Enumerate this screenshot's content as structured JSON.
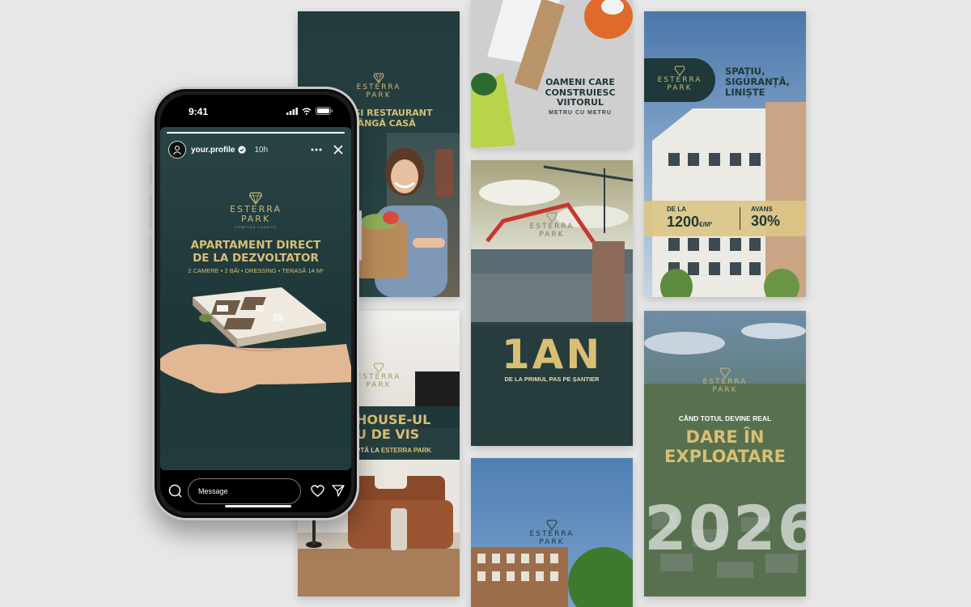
{
  "phone": {
    "status_time": "9:41",
    "story": {
      "profile_name": "your.profile",
      "time_ago": "10h",
      "progress": 1.0,
      "brand_line1": "ESTERRA",
      "brand_line2": "PARK",
      "brand_sub": "COMPLEX LOCATIV",
      "headline_line1": "APARTAMENT DIRECT",
      "headline_line2": "DE LA DEZVOLTATOR",
      "features": "2 CAMERE • 2 BĂI • DRESSING • TERASĂ 14 M²"
    },
    "reply_placeholder": "Message"
  },
  "cards": {
    "market": {
      "headline_line1": "RKET ȘI RESTAURANT",
      "headline_line2": "R LÂNGĂ CASĂ"
    },
    "workers": {
      "headline_line1": "OAMENI CARE",
      "headline_line2": "CONSTRUIESC",
      "headline_line3": "VIITORUL",
      "subline": "METRU CU METRU"
    },
    "building": {
      "headline_line1": "SPAȚIU,",
      "headline_line2": "SIGURANȚĂ,",
      "headline_line3": "LINIȘTE",
      "price_label": "DE LA",
      "price_value": "1200",
      "price_unit": "€/M²",
      "advance_label": "AVANS",
      "advance_value": "30%"
    },
    "one_year": {
      "big_text": "1AN",
      "subline": "DE LA PRIMUL PAS PE ȘANTIER"
    },
    "penthouse": {
      "headline_line1": "HOUSE-UL",
      "headline_line2": "U DE VIS",
      "subline_prefix": "PTĂ LA",
      "subline_brand": "ESTERRA PARK"
    },
    "year_2026": {
      "kicker": "CÂND TOTUL DEVINE REAL",
      "headline_line1": "DARE ÎN",
      "headline_line2": "EXPLOATARE",
      "big_year": "2026"
    }
  },
  "colors": {
    "gold": "#d8bf74",
    "dark_teal": "#1f3839",
    "background": "#e7e7e7"
  },
  "icons": [
    "search-icon",
    "heart-icon",
    "send-icon",
    "more-icon",
    "close-icon",
    "verified-icon"
  ]
}
